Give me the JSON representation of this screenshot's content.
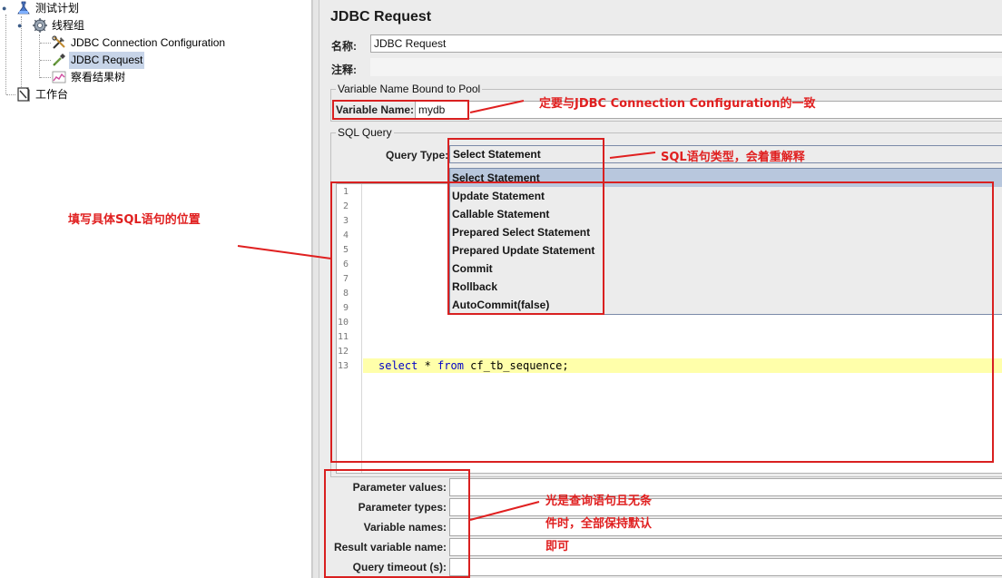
{
  "tree": {
    "items": [
      {
        "label": "测试计划",
        "icon": "test-plan-icon"
      },
      {
        "label": "线程组",
        "icon": "thread-group-gear-icon"
      },
      {
        "label": "JDBC Connection Configuration",
        "icon": "config-tools-icon"
      },
      {
        "label": "JDBC Request",
        "icon": "sampler-pipette-icon"
      },
      {
        "label": "察看结果树",
        "icon": "result-tree-chart-icon"
      },
      {
        "label": "工作台",
        "icon": "workbench-icon"
      }
    ]
  },
  "panel": {
    "title": "JDBC Request",
    "name_label": "名称:",
    "name_value": "JDBC Request",
    "comment_label": "注释:",
    "comment_value": ""
  },
  "variable_group": {
    "legend": "Variable Name Bound to Pool",
    "label": "Variable Name:",
    "value": "mydb"
  },
  "sql_group": {
    "legend": "SQL Query",
    "query_type_label": "Query Type:",
    "query_type_value": "Select Statement",
    "dropdown_options": [
      "Select Statement",
      "Update Statement",
      "Callable Statement",
      "Prepared Select Statement",
      "Prepared Update Statement",
      "Commit",
      "Rollback",
      "AutoCommit(false)"
    ],
    "highlighted_option": "Select Statement"
  },
  "editor": {
    "line_numbers": [
      "1",
      "2",
      "3",
      "4",
      "5",
      "6",
      "7",
      "8",
      "9",
      "10",
      "11",
      "12",
      "13"
    ],
    "sql": {
      "kw_select": "select",
      "star": " * ",
      "kw_from": "from",
      "rest": " cf_tb_sequence;"
    },
    "current_line": 13
  },
  "params": [
    {
      "label": "Parameter values:",
      "value": ""
    },
    {
      "label": "Parameter types:",
      "value": ""
    },
    {
      "label": "Variable names:",
      "value": ""
    },
    {
      "label": "Result variable name:",
      "value": ""
    },
    {
      "label": "Query timeout (s):",
      "value": ""
    }
  ],
  "annotations": {
    "variable_note": "定要与JDBC Connection Configuration的一致",
    "query_type_note": "SQL语句类型，会着重解释",
    "sql_position_note": "填写具体SQL语句的位置",
    "params_note_line1": "光是查询语句且无条",
    "params_note_line2": "件时，全部保持默认",
    "params_note_line3": "即可"
  },
  "colors": {
    "annotation_red": "#e02020",
    "selection_blue": "#c7d4e8",
    "dropdown_highlight": "#b8c7dd",
    "current_line_yellow": "#ffffaa",
    "keyword_blue": "#0000c8"
  }
}
